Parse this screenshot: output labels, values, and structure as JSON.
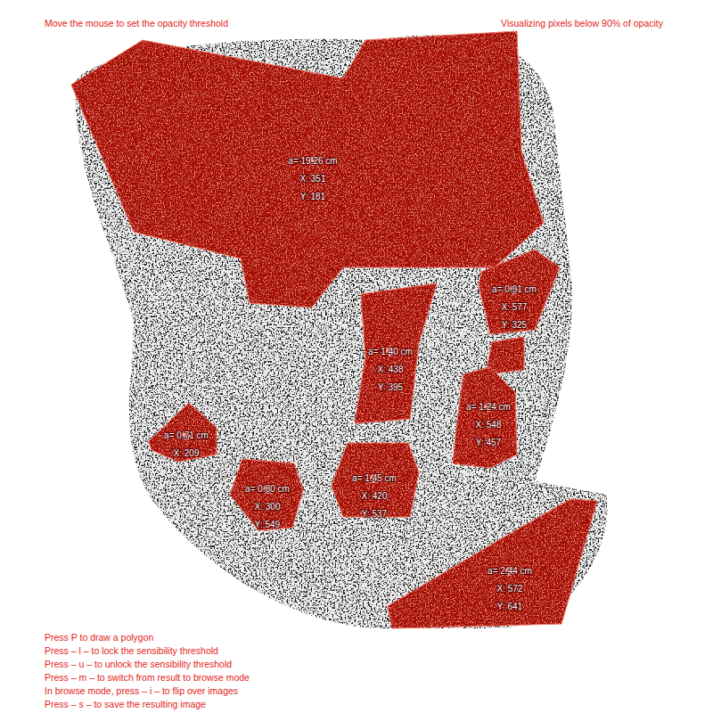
{
  "header": {
    "hint": "Move the mouse to set the opacity threshold",
    "status": "Visualizing pixels below 90% of opacity"
  },
  "regions": [
    {
      "lines": [
        "a= 19.26 cm",
        "X: 351",
        "Y: 181"
      ]
    },
    {
      "lines": [
        "a= 0.91 cm",
        "X: 577",
        "Y: 325"
      ]
    },
    {
      "lines": [
        "a= 1.40 cm",
        "X: 438",
        "Y: 395"
      ]
    },
    {
      "lines": []
    },
    {
      "lines": [
        "a= 1.24 cm",
        "X: 548",
        "Y: 457"
      ]
    },
    {
      "lines": [
        "a= 0.71 cm",
        "X: 209"
      ]
    },
    {
      "lines": [
        "a= 0.80 cm",
        "X: 300",
        "Y: 549"
      ]
    },
    {
      "lines": [
        "a= 1.45 cm",
        "X: 420",
        "Y: 537"
      ]
    },
    {
      "lines": [
        "a= 2.44 cm",
        "X: 572",
        "Y: 641"
      ]
    }
  ],
  "instructions": [
    "Press P to draw a polygon",
    "Press – l – to lock the sensibility threshold",
    "Press – u – to unlock the sensibility threshold",
    "Press – m – to switch from result to browse mode",
    "In browse mode, press – i – to flip over images",
    "Press – s – to save the resulting image"
  ]
}
